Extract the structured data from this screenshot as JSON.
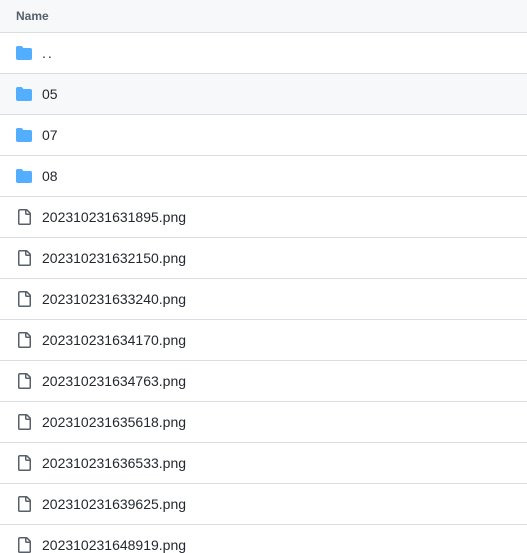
{
  "header": {
    "name_label": "Name"
  },
  "colors": {
    "folder_icon": "#54aeff",
    "file_icon": "#57606a",
    "row_border": "#d8dee4",
    "header_bg": "#f6f8fa",
    "highlight_bg": "#f6f8fa"
  },
  "rows": [
    {
      "label": "..",
      "type": "folder",
      "icon": "folder-icon",
      "highlighted": false
    },
    {
      "label": "05",
      "type": "folder",
      "icon": "folder-icon",
      "highlighted": true
    },
    {
      "label": "07",
      "type": "folder",
      "icon": "folder-icon",
      "highlighted": false
    },
    {
      "label": "08",
      "type": "folder",
      "icon": "folder-icon",
      "highlighted": false
    },
    {
      "label": "202310231631895.png",
      "type": "file",
      "icon": "file-icon",
      "highlighted": false
    },
    {
      "label": "202310231632150.png",
      "type": "file",
      "icon": "file-icon",
      "highlighted": false
    },
    {
      "label": "202310231633240.png",
      "type": "file",
      "icon": "file-icon",
      "highlighted": false
    },
    {
      "label": "202310231634170.png",
      "type": "file",
      "icon": "file-icon",
      "highlighted": false
    },
    {
      "label": "202310231634763.png",
      "type": "file",
      "icon": "file-icon",
      "highlighted": false
    },
    {
      "label": "202310231635618.png",
      "type": "file",
      "icon": "file-icon",
      "highlighted": false
    },
    {
      "label": "202310231636533.png",
      "type": "file",
      "icon": "file-icon",
      "highlighted": false
    },
    {
      "label": "202310231639625.png",
      "type": "file",
      "icon": "file-icon",
      "highlighted": false
    },
    {
      "label": "202310231648919.png",
      "type": "file",
      "icon": "file-icon",
      "highlighted": false
    }
  ]
}
